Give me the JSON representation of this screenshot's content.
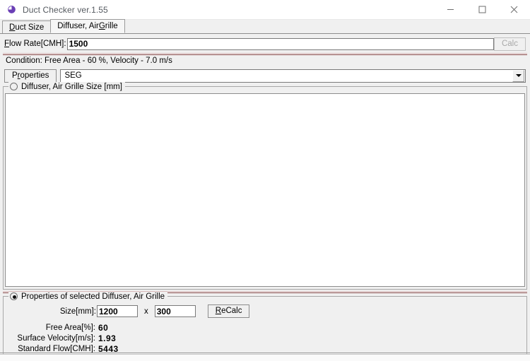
{
  "window": {
    "title": "Duct Checker ver.1.55",
    "app_icon": "duct-checker-icon",
    "minimize_label": "–",
    "maximize_label": "□",
    "close_label": "×",
    "accent_color": "#6a3fb5",
    "separator_color": "#8b4a4a",
    "background_color": "#f0f0f0"
  },
  "tabs": [
    {
      "label": "Duct Size",
      "accelerator": "D",
      "active": false
    },
    {
      "label": "Diffuser, Air Grille",
      "accelerator": "G",
      "active": true
    }
  ],
  "flow_rate": {
    "label": "Flow Rate[CMH]:",
    "accelerator": "F",
    "value": "1500",
    "placeholder": ""
  },
  "calc_button": {
    "label": "Calc",
    "enabled": false
  },
  "condition": {
    "text": "Condition: Free Area -  60 %, Velocity -   7.0 m/s"
  },
  "properties": {
    "button_label": "Properties",
    "accelerator": "r",
    "combo_value": "SEG",
    "combo_arrow_icon": "chevron-down-icon"
  },
  "size_group": {
    "legend": "Diffuser, Air Grille Size [mm]",
    "radio_selected": false,
    "list_items": []
  },
  "selected_group": {
    "legend": "Properties of selected Diffuser, Air Grille",
    "radio_selected": true,
    "size_label": "Size[mm]:",
    "width_value": "1200",
    "multiply_symbol": "x",
    "height_value": "300",
    "recalc_label": "ReCalc",
    "recalc_accelerator": "R",
    "results": [
      {
        "label": "Free Area[%]:",
        "value": "60"
      },
      {
        "label": "Surface Velocity[m/s]:",
        "value": "1.93"
      },
      {
        "label": "Standard Flow[CMH]:",
        "value": "5443"
      }
    ]
  }
}
